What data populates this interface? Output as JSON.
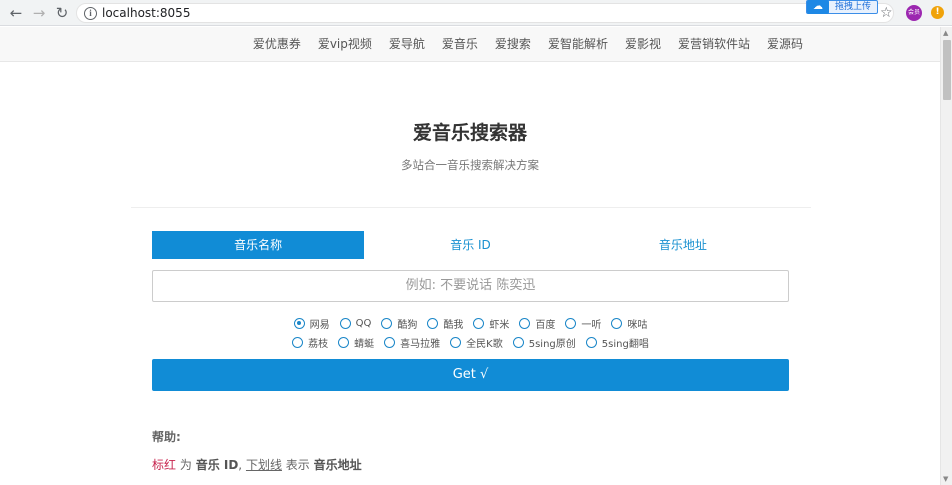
{
  "browser": {
    "url": "localhost:8055",
    "ext_upload_label": "拖拽上传",
    "avatar_text": "会员",
    "alert_text": "!"
  },
  "nav": {
    "items": [
      "爱优惠券",
      "爱vip视频",
      "爱导航",
      "爱音乐",
      "爱搜索",
      "爱智能解析",
      "爱影视",
      "爱营销软件站",
      "爱源码"
    ]
  },
  "header": {
    "title": "爱音乐搜索器",
    "subtitle": "多站合一音乐搜索解决方案"
  },
  "tabs": [
    {
      "label": "音乐名称",
      "active": true
    },
    {
      "label": "音乐 ID",
      "active": false
    },
    {
      "label": "音乐地址",
      "active": false
    }
  ],
  "search": {
    "placeholder": "例如: 不要说话 陈奕迅"
  },
  "sources": {
    "row1": [
      {
        "label": "网易",
        "checked": true
      },
      {
        "label": "QQ",
        "checked": false
      },
      {
        "label": "酷狗",
        "checked": false
      },
      {
        "label": "酷我",
        "checked": false
      },
      {
        "label": "虾米",
        "checked": false
      },
      {
        "label": "百度",
        "checked": false
      },
      {
        "label": "一听",
        "checked": false
      },
      {
        "label": "咪咕",
        "checked": false
      }
    ],
    "row2": [
      {
        "label": "荔枝",
        "checked": false
      },
      {
        "label": "蜻蜓",
        "checked": false
      },
      {
        "label": "喜马拉雅",
        "checked": false
      },
      {
        "label": "全民K歌",
        "checked": false
      },
      {
        "label": "5sing原创",
        "checked": false
      },
      {
        "label": "5sing翻唱",
        "checked": false
      }
    ]
  },
  "get_button": "Get √",
  "help": {
    "title": "帮助:",
    "red_word": "标红",
    "is": "为",
    "music_id": "音乐 ID",
    "comma": ",",
    "underline_word": "下划线",
    "means": "表示",
    "music_url": "音乐地址"
  }
}
